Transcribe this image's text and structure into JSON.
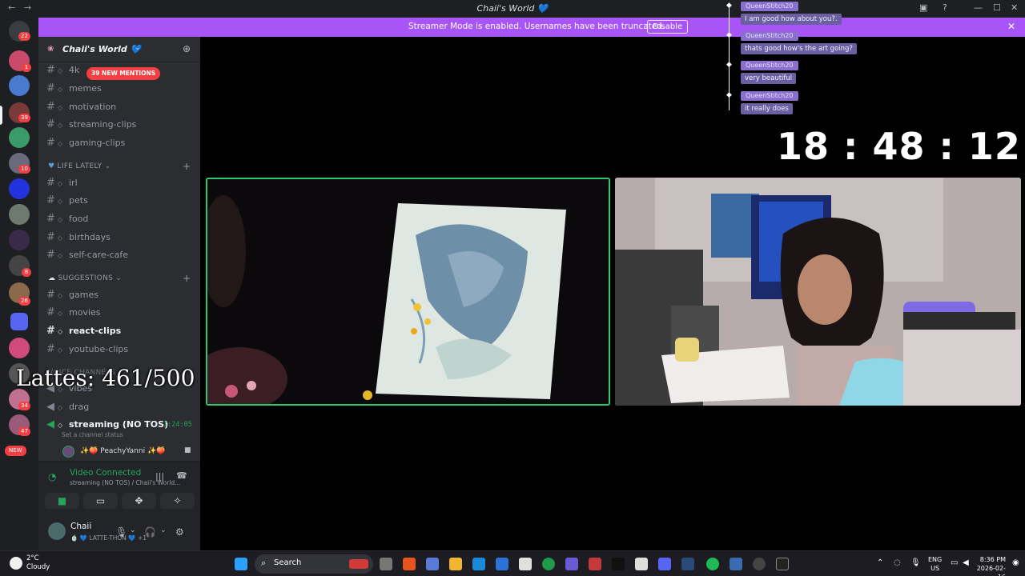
{
  "window": {
    "title": "Chaii's World 💙"
  },
  "banner": {
    "text": "Streamer Mode is enabled. Usernames have been truncated.",
    "disable_label": "Disable"
  },
  "rail": {
    "badges": [
      "22",
      "1",
      "39",
      "10",
      "8",
      "26",
      "34",
      "47"
    ],
    "new_label": "NEW"
  },
  "server": {
    "name": "Chaii's World 💙"
  },
  "mentions_pill": "39 NEW MENTIONS",
  "channels_top": [
    "4k",
    "memes",
    "motivation",
    "streaming-clips",
    "gaming-clips"
  ],
  "categories": {
    "life_lately": "LIFE LATELY",
    "suggestions": "SUGGESTIONS",
    "voice_partial": "VOICE CHANNELS"
  },
  "channels_life": [
    "irl",
    "pets",
    "food",
    "birthdays",
    "self-care-cafe"
  ],
  "channels_suggest": [
    "games",
    "movies",
    "react-clips",
    "youtube-clips"
  ],
  "voice_channels": [
    "vibes",
    "drag",
    "streaming (NO TOS)"
  ],
  "voice": {
    "timer": "1:24:05",
    "status_hint": "Set a channel status",
    "participant": "✨🍑 PeachyYanni ✨🍑",
    "connected": "Video Connected",
    "location": "streaming (NO TOS) / Chaii's World..."
  },
  "overlay_text": "Lattes: 461/500",
  "user": {
    "name": "Chaii",
    "status": "🍵 💙 LATTE-THON 💙 +1"
  },
  "chat": [
    {
      "user": "QueenStitch20",
      "msg": "I am good how about you?."
    },
    {
      "user": "QueenStitch20",
      "msg": "thats good how's the art going?"
    },
    {
      "user": "QueenStitch20",
      "msg": "very beautiful"
    },
    {
      "user": "QueenStitch20",
      "msg": "it really does"
    }
  ],
  "clock": "18 : 48 : 12",
  "taskbar": {
    "temp": "2°C",
    "condition": "Cloudy",
    "search_label": "Search",
    "lang1": "ENG",
    "lang2": "US",
    "time": "8:36 PM",
    "date": "2026-02-16"
  },
  "colors": {
    "accent_banner": "#a855f7",
    "voice_green": "#23a55a",
    "mention_red": "#f23f43"
  }
}
